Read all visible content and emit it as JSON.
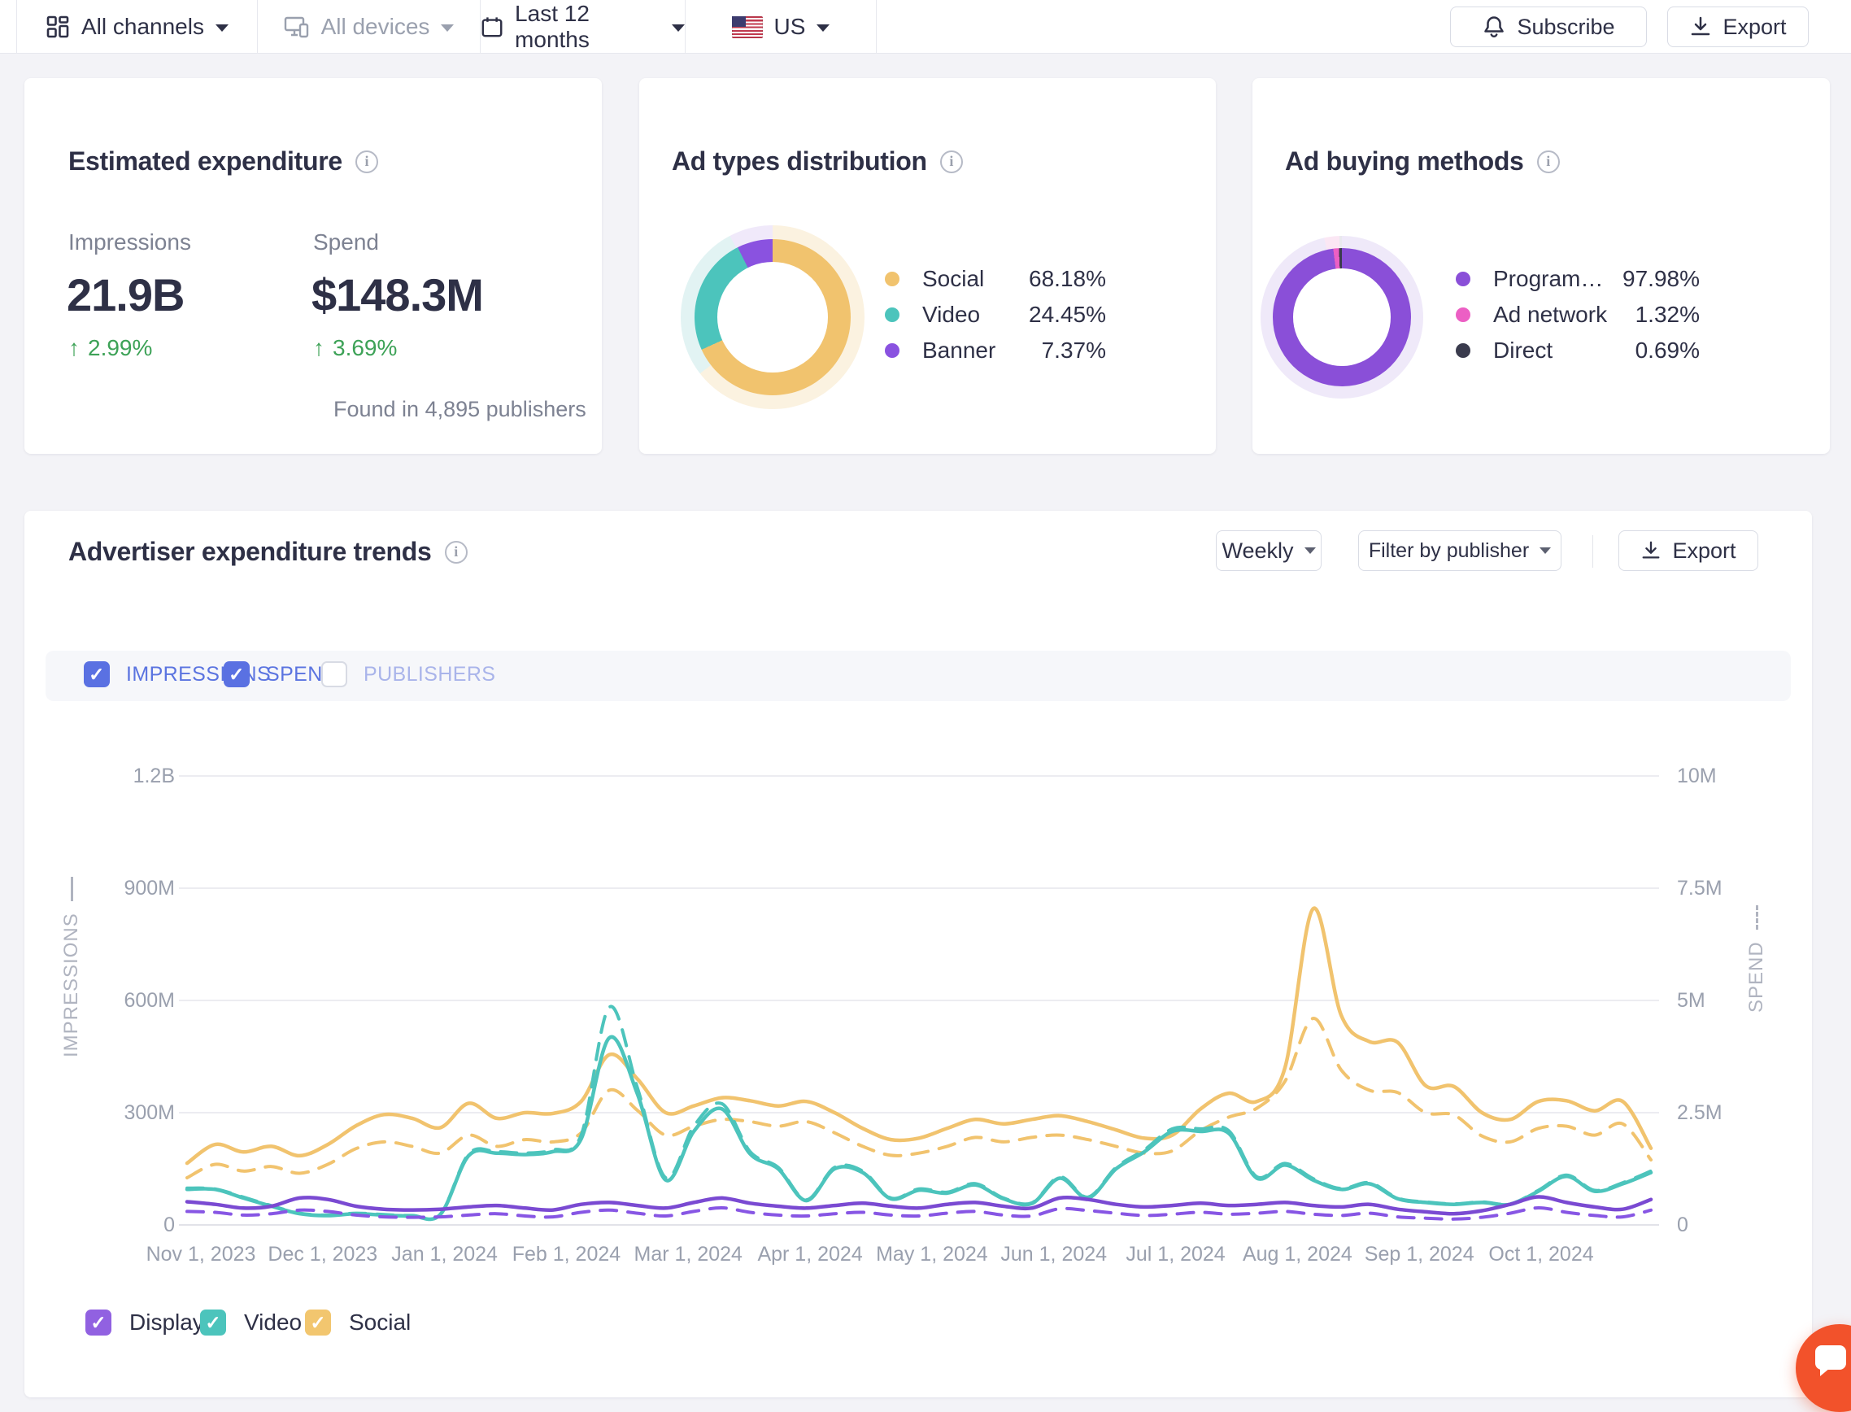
{
  "misc": {
    "up_arrow": "↑"
  },
  "topbar": {
    "channels": "All channels",
    "devices": "All devices",
    "date_range": "Last 12 months",
    "country": "US",
    "subscribe": "Subscribe",
    "export": "Export"
  },
  "cards": {
    "expenditure": {
      "title": "Estimated expenditure",
      "impressions_label": "Impressions",
      "impressions_value": "21.9B",
      "impressions_delta": "2.99%",
      "spend_label": "Spend",
      "spend_value": "$148.3M",
      "spend_delta": "3.69%",
      "found_in": "Found in 4,895 publishers"
    },
    "ad_types": {
      "title": "Ad types distribution"
    },
    "buying_methods": {
      "title": "Ad buying methods"
    }
  },
  "trends": {
    "title": "Advertiser expenditure trends",
    "interval_button": "Weekly",
    "filter_button": "Filter by publisher",
    "export_button": "Export",
    "toggles": [
      {
        "label": "IMPRESSIONS",
        "checked": true
      },
      {
        "label": "SPEND",
        "checked": true
      },
      {
        "label": "PUBLISHERS",
        "checked": false
      }
    ],
    "legend": [
      {
        "label": "Display",
        "color": "#9161e1",
        "checked": true
      },
      {
        "label": "Video",
        "color": "#4cc4bc",
        "checked": true
      },
      {
        "label": "Social",
        "color": "#f2c66f",
        "checked": true
      }
    ]
  },
  "chart_data": [
    {
      "type": "pie",
      "title": "Ad types distribution",
      "donut": true,
      "segments": [
        {
          "label": "Social",
          "value": 68.18,
          "value_label": "68.18%",
          "color": "#f1c36e",
          "pale": "#fbf2e0",
          "pale_value": 64.5
        },
        {
          "label": "Video",
          "value": 24.45,
          "value_label": "24.45%",
          "color": "#4cc4bc",
          "pale": "#e2f3f3",
          "pale_value": 27.8
        },
        {
          "label": "Banner",
          "value": 7.37,
          "value_label": "7.37%",
          "color": "#8a52e0",
          "pale": "#f0e9fa",
          "pale_value": 7.7
        }
      ]
    },
    {
      "type": "pie",
      "title": "Ad buying methods",
      "donut": true,
      "segments": [
        {
          "label": "Program…",
          "value": 97.98,
          "value_label": "97.98%",
          "color": "#8a4fd8",
          "pale": "#efe9f9",
          "pale_value": 96.5
        },
        {
          "label": "Ad network",
          "value": 1.32,
          "value_label": "1.32%",
          "color": "#ec5fc4",
          "pale": "#fbe7f4",
          "pale_value": 3.0
        },
        {
          "label": "Direct",
          "value": 0.69,
          "value_label": "0.69%",
          "color": "#3a3b4d",
          "pale": "#e9e9ee",
          "pale_value": 0.5
        }
      ]
    },
    {
      "type": "line",
      "title": "Advertiser expenditure trends",
      "interval": "Weekly",
      "grid": true,
      "legend_position": "bottom",
      "x_tick_labels": [
        "Nov 1, 2023",
        "Dec 1, 2023",
        "Jan 1, 2024",
        "Feb 1, 2024",
        "Mar 1, 2024",
        "Apr 1, 2024",
        "May 1, 2024",
        "Jun 1, 2024",
        "Jul 1, 2024",
        "Aug 1, 2024",
        "Sep 1, 2024",
        "Oct 1, 2024"
      ],
      "left_axis": {
        "label": "IMPRESSIONS",
        "ticks": [
          "1.2B",
          "900M",
          "600M",
          "300M",
          "0"
        ],
        "max": 1200,
        "unit": "millions of impressions"
      },
      "right_axis": {
        "label": "SPEND",
        "ticks": [
          "10M",
          "7.5M",
          "5M",
          "2.5M",
          "0"
        ],
        "max": 10,
        "unit": "millions of dollars"
      },
      "series": [
        {
          "name": "Social spend",
          "axis": "right",
          "style": "dashed",
          "color": "#f1c36e",
          "values": [
            1.05,
            1.35,
            1.2,
            1.3,
            1.15,
            1.35,
            1.7,
            1.85,
            1.75,
            1.6,
            2.0,
            1.75,
            1.9,
            1.85,
            2.05,
            3.0,
            2.55,
            2.0,
            2.2,
            2.35,
            2.3,
            2.2,
            2.3,
            2.05,
            1.75,
            1.55,
            1.6,
            1.75,
            1.95,
            1.85,
            1.95,
            2.0,
            1.9,
            1.75,
            1.6,
            1.65,
            2.1,
            2.4,
            2.6,
            3.2,
            4.6,
            3.45,
            3.0,
            2.95,
            2.5,
            2.45,
            1.98,
            1.85,
            2.15,
            2.2,
            2.0,
            2.25,
            1.45
          ]
        },
        {
          "name": "Social impressions",
          "axis": "left",
          "style": "solid",
          "color": "#f1c36e",
          "values": [
            165,
            215,
            195,
            210,
            185,
            215,
            265,
            295,
            285,
            260,
            325,
            285,
            300,
            298,
            330,
            455,
            390,
            300,
            318,
            340,
            332,
            318,
            330,
            300,
            258,
            228,
            232,
            258,
            282,
            270,
            282,
            292,
            276,
            254,
            232,
            240,
            310,
            352,
            330,
            420,
            845,
            560,
            490,
            488,
            372,
            370,
            300,
            282,
            330,
            332,
            305,
            330,
            205
          ]
        },
        {
          "name": "Video spend",
          "axis": "right",
          "style": "dashed",
          "color": "#4cc4bc",
          "values": [
            0.82,
            0.8,
            0.62,
            0.43,
            0.26,
            0.22,
            0.26,
            0.23,
            0.21,
            0.24,
            1.58,
            1.63,
            1.6,
            1.67,
            2.0,
            4.85,
            3.05,
            1.05,
            2.2,
            2.7,
            1.63,
            1.28,
            0.56,
            1.28,
            1.2,
            0.6,
            0.8,
            0.73,
            0.92,
            0.6,
            0.49,
            1.07,
            0.62,
            1.28,
            1.67,
            2.14,
            2.14,
            2.1,
            1.07,
            1.37,
            1.03,
            0.81,
            0.94,
            0.6,
            0.51,
            0.47,
            0.51,
            0.47,
            0.77,
            1.11,
            0.77,
            0.94,
            1.2
          ]
        },
        {
          "name": "Video impressions",
          "axis": "left",
          "style": "solid",
          "color": "#4cc4bc",
          "values": [
            95,
            95,
            72,
            50,
            30,
            25,
            30,
            26,
            24,
            28,
            185,
            192,
            188,
            196,
            230,
            500,
            350,
            120,
            250,
            310,
            190,
            150,
            65,
            150,
            140,
            70,
            93,
            85,
            107,
            70,
            57,
            125,
            72,
            150,
            195,
            250,
            250,
            245,
            125,
            160,
            120,
            95,
            110,
            70,
            60,
            55,
            60,
            55,
            90,
            130,
            90,
            110,
            140
          ]
        },
        {
          "name": "Display spend",
          "axis": "right",
          "style": "dashed",
          "color": "#8756e4",
          "values": [
            0.3,
            0.28,
            0.22,
            0.25,
            0.33,
            0.3,
            0.22,
            0.18,
            0.17,
            0.18,
            0.22,
            0.25,
            0.2,
            0.18,
            0.28,
            0.33,
            0.26,
            0.2,
            0.3,
            0.38,
            0.28,
            0.22,
            0.2,
            0.25,
            0.28,
            0.22,
            0.2,
            0.26,
            0.3,
            0.22,
            0.2,
            0.36,
            0.32,
            0.26,
            0.21,
            0.24,
            0.28,
            0.24,
            0.26,
            0.3,
            0.24,
            0.21,
            0.26,
            0.18,
            0.15,
            0.13,
            0.17,
            0.26,
            0.38,
            0.28,
            0.21,
            0.18,
            0.33
          ]
        },
        {
          "name": "Display impressions",
          "axis": "left",
          "style": "solid",
          "color": "#7a4ad2",
          "values": [
            62,
            55,
            45,
            50,
            72,
            68,
            50,
            42,
            40,
            42,
            48,
            52,
            45,
            40,
            55,
            60,
            52,
            45,
            60,
            72,
            58,
            50,
            45,
            52,
            58,
            50,
            45,
            55,
            60,
            50,
            45,
            72,
            68,
            55,
            48,
            52,
            58,
            52,
            55,
            60,
            52,
            48,
            55,
            42,
            35,
            30,
            38,
            55,
            75,
            60,
            48,
            42,
            68
          ]
        }
      ]
    }
  ]
}
